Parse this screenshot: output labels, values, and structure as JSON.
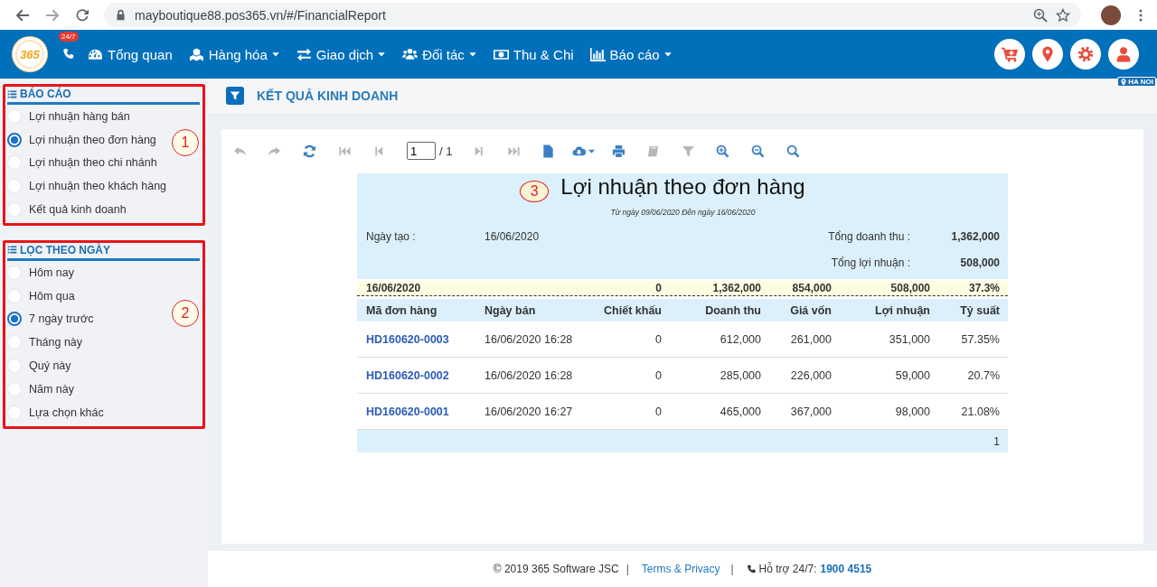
{
  "browser": {
    "url": "mayboutique88.pos365.vn/#/FinancialReport"
  },
  "navbar": {
    "logo_text": "365",
    "hotline_badge": "24/7",
    "location": "HA NOI",
    "menu": [
      {
        "label": "Tổng quan",
        "kind": "dashboard",
        "dropdown": false
      },
      {
        "label": "Hàng hóa",
        "kind": "boxes",
        "dropdown": true
      },
      {
        "label": "Giao dịch",
        "kind": "swap",
        "dropdown": true
      },
      {
        "label": "Đối tác",
        "kind": "users",
        "dropdown": true
      },
      {
        "label": "Thu & Chi",
        "kind": "banknote",
        "dropdown": false
      },
      {
        "label": "Báo cáo",
        "kind": "barchart",
        "dropdown": true
      }
    ],
    "actions": [
      {
        "kind": "cart"
      },
      {
        "kind": "pin"
      },
      {
        "kind": "gear"
      },
      {
        "kind": "user"
      }
    ]
  },
  "sidebar": {
    "sections": [
      {
        "title": "BÁO CÁO",
        "highlighted": true,
        "marker": "1",
        "options": [
          {
            "label": "Lợi nhuận hàng bán",
            "selected": false
          },
          {
            "label": "Lợi nhuận theo đơn hàng",
            "selected": true
          },
          {
            "label": "Lợi nhuận theo chi nhánh",
            "selected": false
          },
          {
            "label": "Lợi nhuận theo khách hàng",
            "selected": false
          },
          {
            "label": "Kết quả kinh doanh",
            "selected": false
          }
        ]
      },
      {
        "title": "LỌC THEO NGÀY",
        "highlighted": true,
        "marker": "2",
        "options": [
          {
            "label": "Hôm nay",
            "selected": false
          },
          {
            "label": "Hôm qua",
            "selected": false
          },
          {
            "label": "7 ngày trước",
            "selected": true
          },
          {
            "label": "Tháng này",
            "selected": false
          },
          {
            "label": "Quý này",
            "selected": false
          },
          {
            "label": "Năm này",
            "selected": false
          },
          {
            "label": "Lựa chọn khác",
            "selected": false
          }
        ]
      }
    ]
  },
  "report": {
    "title": "KẾT QUẢ KINH DOANH",
    "toolbar": {
      "left_buttons": [
        {
          "kind": "undo",
          "disabled": true
        },
        {
          "kind": "redo",
          "disabled": true
        },
        {
          "kind": "refresh",
          "disabled": false
        },
        {
          "kind": "first",
          "disabled": true
        },
        {
          "kind": "prev",
          "disabled": true
        }
      ],
      "page": "1",
      "page_total": "/ 1",
      "right_buttons": [
        {
          "kind": "next",
          "disabled": true
        },
        {
          "kind": "last",
          "disabled": true
        },
        {
          "kind": "document",
          "disabled": false
        },
        {
          "kind": "download",
          "disabled": false
        },
        {
          "kind": "print",
          "disabled": false
        },
        {
          "kind": "book",
          "disabled": true
        },
        {
          "kind": "filter",
          "disabled": true
        },
        {
          "kind": "zoomin",
          "disabled": false
        },
        {
          "kind": "zoomout",
          "disabled": false
        },
        {
          "kind": "search",
          "disabled": false
        }
      ]
    },
    "document": {
      "marker": "3",
      "title": "Lợi nhuận theo đơn hàng",
      "date_range": "Từ ngày 09/06/2020 Đến ngày 16/06/2020",
      "created_label": "Ngày tạo :",
      "created_value": "16/06/2020",
      "totals": [
        {
          "label": "Tổng doanh thu :",
          "value": "1,362,000"
        },
        {
          "label": "Tổng lợi nhuận :",
          "value": "508,000"
        }
      ],
      "summary": {
        "date": "16/06/2020",
        "cells": [
          "0",
          "1,362,000",
          "854,000",
          "508,000",
          "37.3%"
        ]
      },
      "columns": [
        "Mã đơn hàng",
        "Ngày bán",
        "Chiết khấu",
        "Doanh thu",
        "Giá vốn",
        "Lợi nhuận",
        "Tỷ suất"
      ],
      "rows": [
        {
          "cells": [
            "HD160620-0003",
            "16/06/2020 16:28",
            "0",
            "612,000",
            "261,000",
            "351,000",
            "57.35%"
          ]
        },
        {
          "cells": [
            "HD160620-0002",
            "16/06/2020 16:28",
            "0",
            "285,000",
            "226,000",
            "59,000",
            "20.7%"
          ]
        },
        {
          "cells": [
            "HD160620-0001",
            "16/06/2020 16:27",
            "0",
            "465,000",
            "367,000",
            "98,000",
            "21.08%"
          ]
        }
      ],
      "page_number": "1"
    }
  },
  "footer": {
    "copyright": "© 2019 365 Software JSC",
    "separators": [
      "|",
      "|"
    ],
    "terms_link": "Terms & Privacy",
    "support_label": "Hỗ trợ 24/7:",
    "support_phone": "1900 4515"
  }
}
